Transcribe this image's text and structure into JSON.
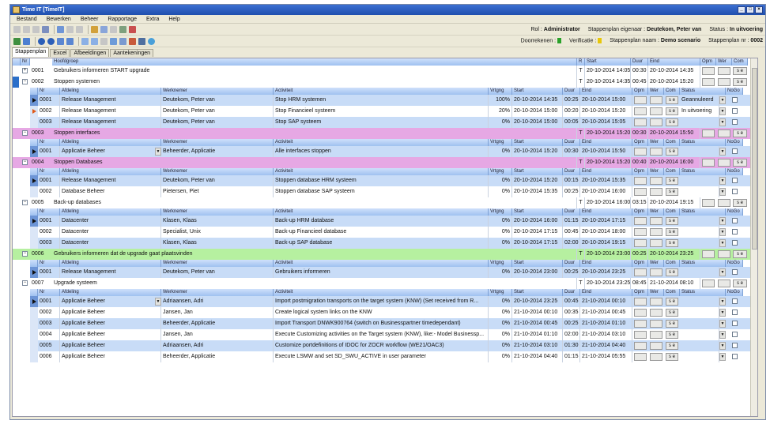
{
  "window": {
    "title": "Time IT [TimeIT]"
  },
  "menu": [
    "Bestand",
    "Bewerken",
    "Beheer",
    "Rapportage",
    "Extra",
    "Help"
  ],
  "info1": {
    "rol_label": "Rol :",
    "rol_value": "Administrator",
    "eig_label": "Stappenplan eigenaar :",
    "eig_value": "Deutekom, Peter van",
    "status_label": "Status :",
    "status_value": "In uitvoering"
  },
  "info2": {
    "doorrekenen": "Doorrekenen :",
    "verificatie": "Verificatie :",
    "naam_label": "Stappenplan naam :",
    "naam_value": "Demo scenario",
    "nr_label": "Stappenplan nr :",
    "nr_value": "0002"
  },
  "tabs": [
    "Stappenplan",
    "Excel",
    "Afbeeldingen",
    "Aantekeningen"
  ],
  "grid": {
    "main_header": {
      "nr": "Nr",
      "hoofdgroep": "Hoofdgroep",
      "r": "R",
      "start": "Start",
      "duur": "Duur",
      "eind": "Eind",
      "opm": "Opm",
      "wer": "Wer",
      "com": "Com"
    },
    "sub_header": {
      "nr": "Nr",
      "afdeling": "Afdeling",
      "werknemer": "Werknemer",
      "activiteit": "Activiteit",
      "vrtg": "Vrtgng",
      "start": "Start",
      "duur": "Duur",
      "eind": "Eind",
      "opm": "Opm",
      "wer": "Wer",
      "com": "Com",
      "status": "Status",
      "nogo": "NoGo"
    },
    "groups": [
      {
        "nr": "0001",
        "title": "Gebruikers informeren START upgrade",
        "r": "T",
        "start": "20-10-2014 14:05",
        "duur": "00:30",
        "eind": "20-10-2014 14:35",
        "btn": "s e"
      },
      {
        "nr": "0002",
        "title": "Stoppen systemen",
        "r": "T",
        "start": "20-10-2014 14:35",
        "duur": "00:45",
        "eind": "20-10-2014 15:20",
        "btn": "s e",
        "rows": [
          {
            "nr": "0001",
            "afd": "Release Management",
            "wn": "Deutekom, Peter van",
            "act": "Stop HRM systemen",
            "v": "100%",
            "start": "20-10-2014 14:35",
            "duur": "00:25",
            "eind": "20-10-2014 15:00",
            "st": "Geannuleerd"
          },
          {
            "nr": "0002",
            "afd": "Release Management",
            "wn": "Deutekom, Peter van",
            "act": "Stop Financieel systeem",
            "v": "20%",
            "start": "20-10-2014 15:00",
            "duur": "00:20",
            "eind": "20-10-2014 15:20",
            "st": "In uitvoering"
          },
          {
            "nr": "0003",
            "afd": "Release Management",
            "wn": "Deutekom, Peter van",
            "act": "Stop SAP systeem",
            "v": "0%",
            "start": "20-10-2014 15:00",
            "duur": "00:05",
            "eind": "20-10-2014 15:05",
            "st": ""
          }
        ]
      },
      {
        "nr": "0003",
        "title": "Stoppen interfaces",
        "r": "T",
        "start": "20-10-2014 15:20",
        "duur": "00:30",
        "eind": "20-10-2014 15:50",
        "btn": "",
        "rows": [
          {
            "nr": "0001",
            "afd": "Applicatie Beheer",
            "wn": "Beheerder, Applicatie",
            "act": "Alle interfaces stoppen",
            "v": "0%",
            "start": "20-10-2014 15:20",
            "duur": "00:30",
            "eind": "20-10-2014 15:50",
            "st": ""
          }
        ]
      },
      {
        "nr": "0004",
        "title": "Stoppen Databases",
        "r": "T",
        "start": "20-10-2014 15:20",
        "duur": "00:40",
        "eind": "20-10-2014 16:00",
        "btn": "",
        "rows": [
          {
            "nr": "0001",
            "afd": "Release Management",
            "wn": "Deutekom, Peter van",
            "act": "Stoppen database HRM systeem",
            "v": "0%",
            "start": "20-10-2014 15:20",
            "duur": "00:15",
            "eind": "20-10-2014 15:35",
            "st": ""
          },
          {
            "nr": "0002",
            "afd": "Database Beheer",
            "wn": "Pietersen, Piet",
            "act": "Stoppen database SAP systeem",
            "v": "0%",
            "start": "20-10-2014 15:35",
            "duur": "00:25",
            "eind": "20-10-2014 16:00",
            "st": ""
          }
        ]
      },
      {
        "nr": "0005",
        "title": "Back-up databases",
        "r": "T",
        "start": "20-10-2014 16:00",
        "duur": "03:15",
        "eind": "20-10-2014 19:15",
        "btn": "",
        "rows": [
          {
            "nr": "0001",
            "afd": "Datacenter",
            "wn": "Klasen, Klaas",
            "act": "Back-up HRM database",
            "v": "0%",
            "start": "20-10-2014 16:00",
            "duur": "01:15",
            "eind": "20-10-2014 17:15",
            "st": ""
          },
          {
            "nr": "0002",
            "afd": "Datacenter",
            "wn": "Specialist, Unix",
            "act": "Back-up Financieel database",
            "v": "0%",
            "start": "20-10-2014 17:15",
            "duur": "00:45",
            "eind": "20-10-2014 18:00",
            "st": ""
          },
          {
            "nr": "0003",
            "afd": "Datacenter",
            "wn": "Klasen, Klaas",
            "act": "Back-up SAP database",
            "v": "0%",
            "start": "20-10-2014 17:15",
            "duur": "02:00",
            "eind": "20-10-2014 19:15",
            "st": ""
          }
        ]
      },
      {
        "nr": "0006",
        "title": "Gebruikers informeren dat de upgrade gaat plaatsvinden",
        "r": "T",
        "start": "20-10-2014 23:00",
        "duur": "00:25",
        "eind": "20-10-2014 23:25",
        "btn": "",
        "rows": [
          {
            "nr": "0001",
            "afd": "Release Management",
            "wn": "Deutekom, Peter van",
            "act": "Gebruikers informeren",
            "v": "0%",
            "start": "20-10-2014 23:00",
            "duur": "00:25",
            "eind": "20-10-2014 23:25",
            "st": ""
          }
        ]
      },
      {
        "nr": "0007",
        "title": "Upgrade systeem",
        "r": "T",
        "start": "20-10-2014 23:25",
        "duur": "08:45",
        "eind": "21-10-2014 08:10",
        "btn": "",
        "rows": [
          {
            "nr": "0001",
            "afd": "Applicatie Beheer",
            "wn": "Adriaansen, Adri",
            "act": "Import postmigration transports on the target system (KNW) (Set received from R...",
            "v": "0%",
            "start": "20-10-2014 23:25",
            "duur": "00:45",
            "eind": "21-10-2014 00:10",
            "st": ""
          },
          {
            "nr": "0002",
            "afd": "Applicatie Beheer",
            "wn": "Jansen, Jan",
            "act": "Create logical system links on the KNW",
            "v": "0%",
            "start": "21-10-2014 00:10",
            "duur": "00:35",
            "eind": "21-10-2014 00:45",
            "st": ""
          },
          {
            "nr": "0003",
            "afd": "Applicatie Beheer",
            "wn": "Beheerder, Applicatie",
            "act": "Import Transport DNWK900764 (switch on Businesspartner timedependant)",
            "v": "0%",
            "start": "21-10-2014 00:45",
            "duur": "00:25",
            "eind": "21-10-2014 01:10",
            "st": ""
          },
          {
            "nr": "0004",
            "afd": "Applicatie Beheer",
            "wn": "Jansen, Jan",
            "act": "Execute Customizing activities on the Target system (KNW), like:- Model Businessp...",
            "v": "0%",
            "start": "21-10-2014 01:10",
            "duur": "02:00",
            "eind": "21-10-2014 03:10",
            "st": ""
          },
          {
            "nr": "0005",
            "afd": "Applicatie Beheer",
            "wn": "Adriaansen, Adri",
            "act": "Customize portdefinitions of IDOC for ZOCR workflow (WE21/OAC3)",
            "v": "0%",
            "start": "21-10-2014 03:10",
            "duur": "01:30",
            "eind": "21-10-2014 04:40",
            "st": ""
          },
          {
            "nr": "0006",
            "afd": "Applicatie Beheer",
            "wn": "Beheerder, Applicatie",
            "act": "Execute LSMW and set SD_SWU_ACTIVE in user parameter",
            "v": "0%",
            "start": "21-10-2014 04:40",
            "duur": "01:15",
            "eind": "21-10-2014 05:55",
            "st": ""
          }
        ]
      }
    ]
  },
  "colors": {
    "title_bar": "#2a5cc2",
    "header_blue": "#a9c8f2",
    "row_blue": "#c8dcf7",
    "row_alt": "#ffffff",
    "group_pink": "#e6a8e4",
    "group_green": "#b6f0a0",
    "selected": "#2b6fc9",
    "flag_green": "#2aa12a",
    "flag_yellow": "#e7c60a"
  }
}
